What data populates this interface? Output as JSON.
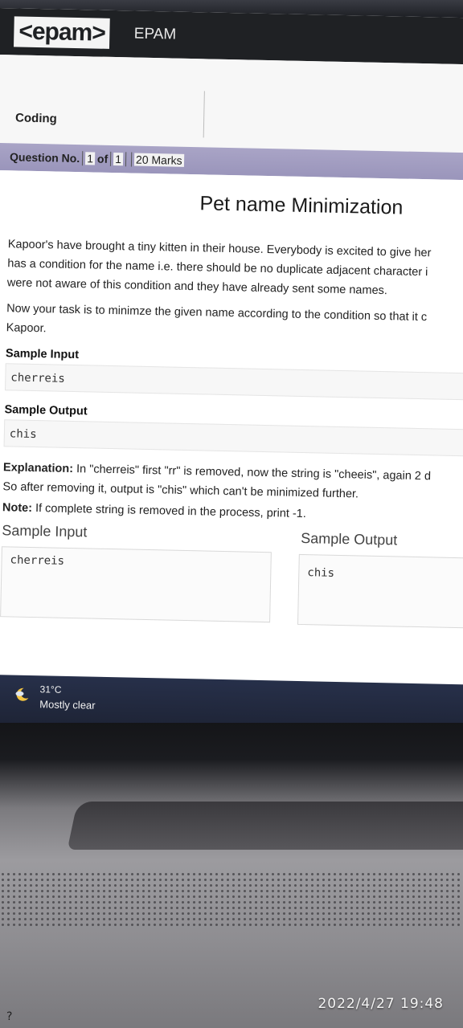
{
  "header": {
    "logo": "<epam>",
    "brand": "EPAM"
  },
  "coding": {
    "label": "Coding"
  },
  "question_bar": {
    "label": "Question No.",
    "current": "1",
    "of_label": "of",
    "total": "1",
    "marks": "20 Marks"
  },
  "problem": {
    "title": "Pet name Minimization",
    "lines": [
      "Kapoor's have brought a tiny kitten in their house. Everybody is excited to give her",
      "has a condition for the name i.e. there should be no duplicate adjacent character i",
      "were not aware of this condition and they have already sent some names.",
      "Now your task is to minimze the given name according to the condition so that it c",
      "Kapoor."
    ],
    "sample_input_label": "Sample Input",
    "sample_input": "cherreis",
    "sample_output_label": "Sample Output",
    "sample_output": "chis",
    "explanation_label": "Explanation:",
    "explanation_line1": " In \"cherreis\" first \"rr\" is removed, now the string is \"cheeis\", again 2 d",
    "explanation_line2": "So after removing it, output is \"chis\" which can't be minimized further.",
    "note_label": "Note:",
    "note_text": " If complete string is removed in the process, print -1."
  },
  "io": {
    "input_label": "Sample Input",
    "input_value": "cherreis",
    "output_label": "Sample Output",
    "output_value": "chis"
  },
  "taskbar": {
    "temperature": "31°C",
    "condition": "Mostly clear",
    "weather_icon": "moon-cloud-icon"
  },
  "photo": {
    "timestamp": "2022/4/27 19:48",
    "key_hint": "?"
  }
}
